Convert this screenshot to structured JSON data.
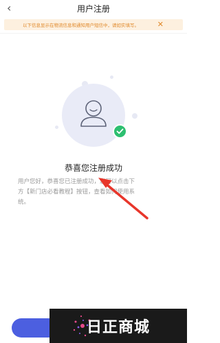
{
  "header": {
    "back_icon": "chevron-left-icon",
    "title": "用户注册"
  },
  "notice": {
    "text": "以下信息显示在物流信息和通知用户短信中，请如实填写。",
    "close_icon": "close-icon"
  },
  "illustration": {
    "avatar_icon": "user-avatar-icon",
    "check_icon": "check-circle-icon"
  },
  "success": {
    "title": "恭喜您注册成功",
    "lines": [
      "用户您好，恭喜您已注册成功，您可以点击下",
      "方【新门店必看教程】按钮，查看如何使用系",
      "统。"
    ]
  },
  "watermark": {
    "text": "日正商城"
  },
  "colors": {
    "accent": "#4c5fe0",
    "notice_bg": "#fdf0df",
    "notice_text": "#e0892b",
    "success_green": "#2dbf70",
    "annotation_red": "#e8362b"
  }
}
